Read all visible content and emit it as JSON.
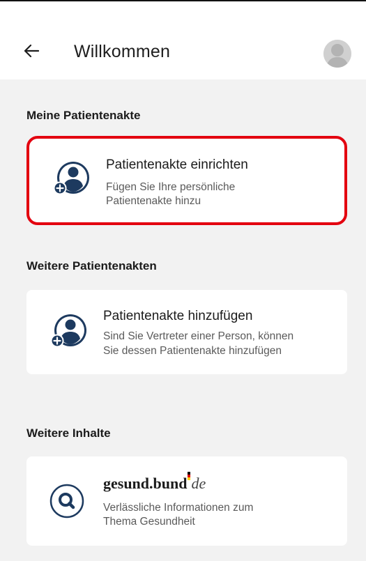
{
  "header": {
    "title": "Willkommen"
  },
  "sections": [
    {
      "title": "Meine Patientenakte"
    },
    {
      "title": "Weitere Patientenakten"
    },
    {
      "title": "Weitere Inhalte"
    }
  ],
  "cards": {
    "setup": {
      "title": "Patientenakte einrichten",
      "desc_line1": "Fügen Sie Ihre persönliche",
      "desc_line2": "Patientenakte hinzu",
      "icon": "add-person-icon"
    },
    "add": {
      "title": "Patientenakte hinzufügen",
      "desc_line1": "Sind Sie Vertreter einer Person, können",
      "desc_line2": "Sie dessen Patientenakte hinzufügen",
      "icon": "add-person-icon"
    },
    "gesund": {
      "brand_main": "gesund.bund",
      "brand_suffix": "de",
      "desc_line1": "Verlässliche Informationen zum",
      "desc_line2": "Thema Gesundheit",
      "icon": "search-icon"
    }
  },
  "colors": {
    "accent": "#1d3a5f",
    "highlight": "#e3000f",
    "background": "#f2f2f2"
  }
}
